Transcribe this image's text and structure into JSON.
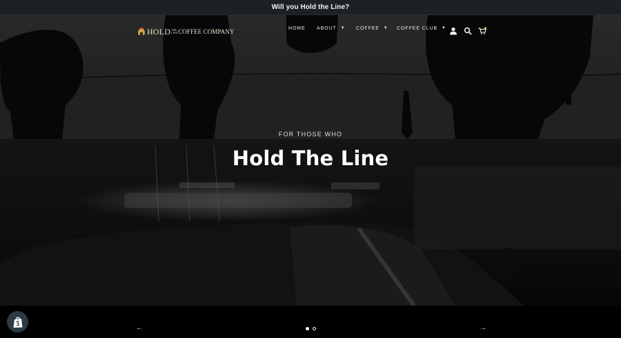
{
  "announcement": {
    "text": "Will you Hold the Line?"
  },
  "header": {
    "logo": {
      "hold": "HOLD",
      "the": "THE LINE",
      "company": "COFFEE COMPANY"
    },
    "nav": [
      {
        "label": "HOME",
        "has_dropdown": false
      },
      {
        "label": "ABOUT",
        "has_dropdown": true
      },
      {
        "label": "COFFEE",
        "has_dropdown": true
      },
      {
        "label": "COFFEE CLUB",
        "has_dropdown": true
      }
    ],
    "icons": [
      "account-icon",
      "search-icon",
      "cart-icon"
    ],
    "cart_count_color": "#e6b43c"
  },
  "hero": {
    "kicker": "FOR THOSE WHO",
    "headline": "Hold The Line"
  },
  "slider": {
    "prev": "←",
    "next": "→",
    "slides": 2,
    "active_index": 0
  },
  "colors": {
    "announcement_bg": "#1d2123",
    "page_bg": "#000000",
    "logo_gold": "#c8a24a"
  }
}
